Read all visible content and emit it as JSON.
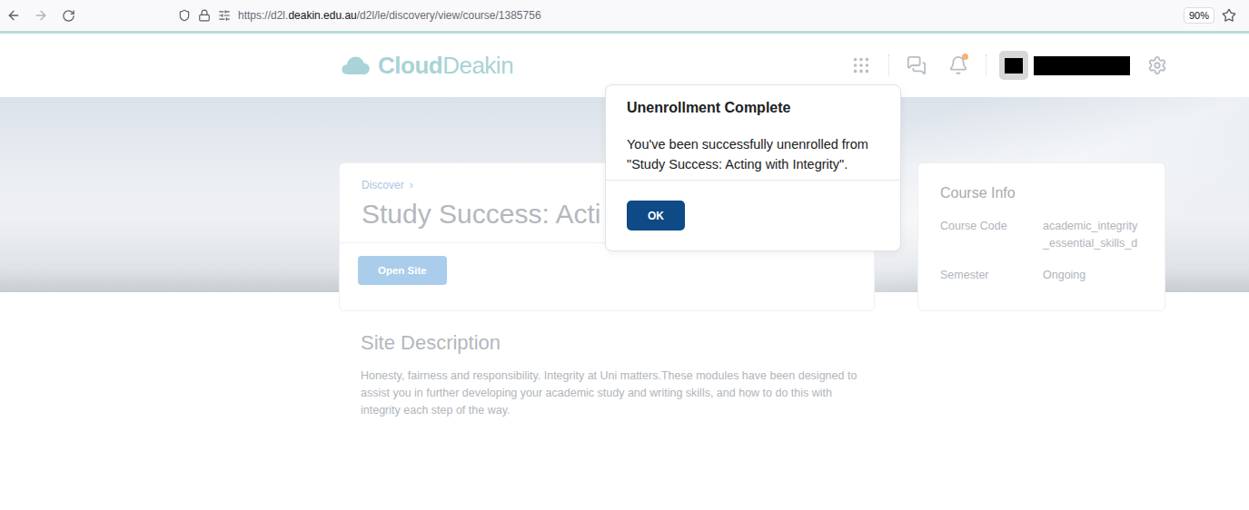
{
  "browser": {
    "url": {
      "prefix": "https://d2l.",
      "domain": "deakin.edu.au",
      "path": "/d2l/le/discovery/view/course/1385756"
    },
    "zoom": "90%"
  },
  "header": {
    "logo": {
      "bold": "Cloud",
      "light": "Deakin"
    },
    "notification_badge": true,
    "user_name_redacted": true
  },
  "course": {
    "breadcrumb": [
      "Discover"
    ],
    "breadcrumb_separator": "›",
    "title": "Study Success: Acti",
    "button": "Open Site"
  },
  "course_info": {
    "title": "Course Info",
    "fields": [
      {
        "label": "Course Code",
        "value": "academic_integrity_essential_skills_d"
      },
      {
        "label": "Semester",
        "value": "Ongoing"
      }
    ]
  },
  "description": {
    "heading": "Site Description",
    "text": "Honesty, fairness and responsibility. Integrity at Uni matters.These modules have been designed to assist you in further developing your academic study and writing skills, and how to do this with integrity each step of the way."
  },
  "dialog": {
    "title": "Unenrollment Complete",
    "message": "You've been successfully unenrolled from \"Study Success: Acting with Integrity\".",
    "buttons": [
      "OK"
    ]
  }
}
